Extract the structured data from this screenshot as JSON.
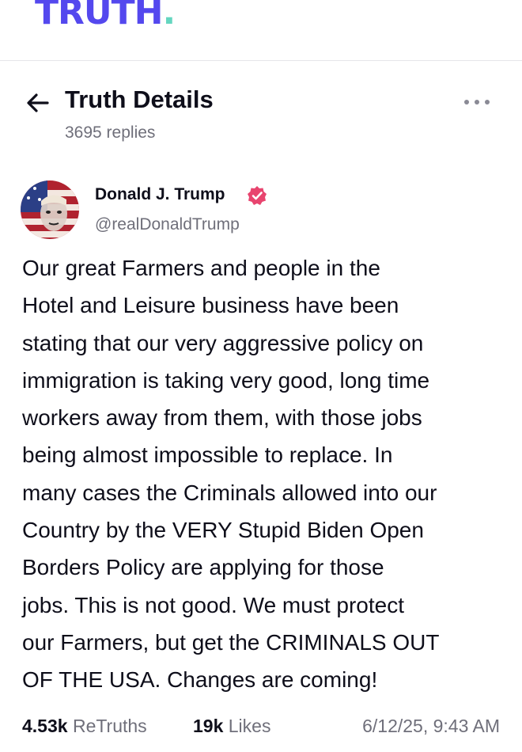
{
  "app": {
    "logo_text": "TRUTH",
    "logo_dot": ".",
    "brand_color": "#5448ee",
    "accent_color": "#65d6c0"
  },
  "header": {
    "title": "Truth Details",
    "replies": "3695 replies",
    "back_icon": "arrow-left-icon",
    "more_icon": "more-horizontal-icon"
  },
  "post": {
    "author_name": "Donald J. Trump",
    "handle": "@realDonaldTrump",
    "verified_icon": "verified-badge-icon",
    "verified_color": "#e8456f",
    "body": "Our great Farmers and people in the\nHotel and Leisure business have been\nstating that our very aggressive policy on\nimmigration is taking very good, long time\nworkers away from them, with those jobs\nbeing almost impossible to replace. In\nmany cases the Criminals allowed into our\nCountry by the VERY Stupid Biden Open\nBorders Policy are applying for those\njobs. This is not good. We must protect\nour Farmers, but get the CRIMINALS OUT\nOF THE USA. Changes are coming!",
    "retruths_count": "4.53k",
    "retruths_label": "ReTruths",
    "likes_count": "19k",
    "likes_label": "Likes",
    "timestamp": "6/12/25, 9:43 AM"
  }
}
